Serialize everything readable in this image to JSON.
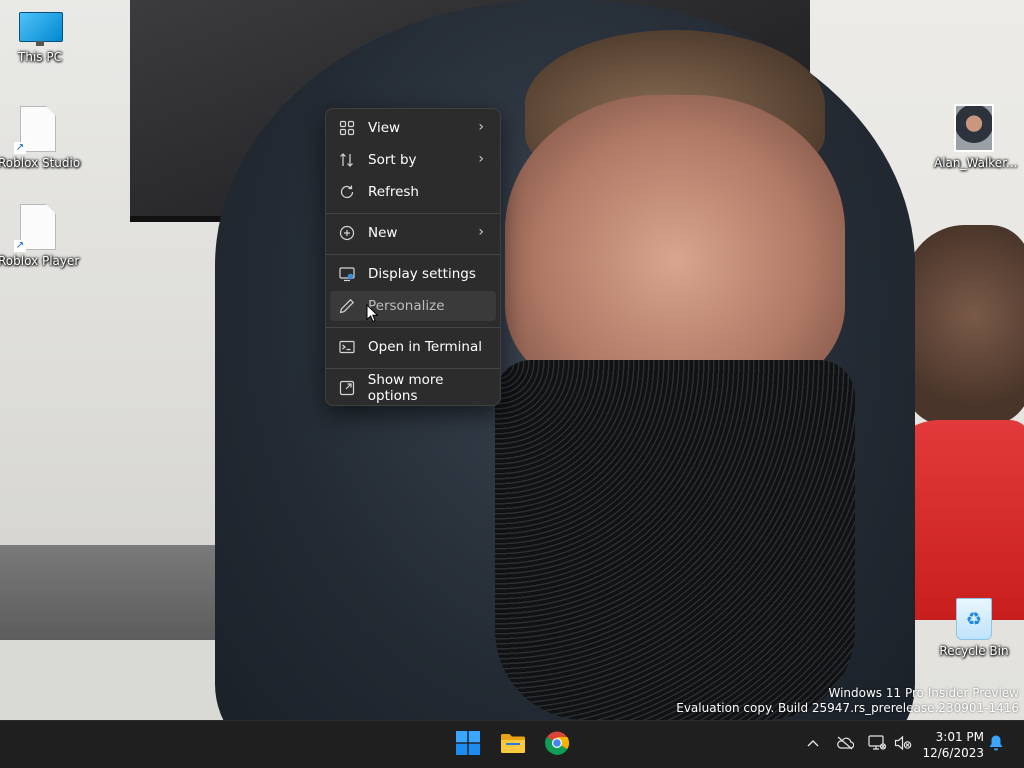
{
  "desktop": {
    "icons": [
      {
        "label": "This PC"
      },
      {
        "label": "Roblox Studio"
      },
      {
        "label": "Roblox Player"
      },
      {
        "label": "Alan_Walker..."
      },
      {
        "label": "Recycle Bin"
      }
    ]
  },
  "context_menu": {
    "items": [
      {
        "label": "View",
        "icon": "grid-view-icon",
        "has_submenu": true
      },
      {
        "label": "Sort by",
        "icon": "sort-icon",
        "has_submenu": true
      },
      {
        "label": "Refresh",
        "icon": "refresh-icon",
        "has_submenu": false
      },
      {
        "label": "New",
        "icon": "plus-circle-icon",
        "has_submenu": true
      },
      {
        "label": "Display settings",
        "icon": "display-settings-icon",
        "has_submenu": false
      },
      {
        "label": "Personalize",
        "icon": "pen-icon",
        "has_submenu": false,
        "hovered": true
      },
      {
        "label": "Open in Terminal",
        "icon": "terminal-icon",
        "has_submenu": false
      },
      {
        "label": "Show more options",
        "icon": "external-options-icon",
        "has_submenu": false
      }
    ]
  },
  "watermark": {
    "line1": "Windows 11 Pro Insider Preview",
    "line2": "Evaluation copy. Build 25947.rs_prerelease.230901-1416"
  },
  "taskbar": {
    "pinned": [
      {
        "name": "Start",
        "icon": "windows-logo-icon"
      },
      {
        "name": "File Explorer",
        "icon": "folder-icon"
      },
      {
        "name": "Google Chrome",
        "icon": "chrome-icon"
      }
    ],
    "tray": {
      "icons": [
        "chevron-up-icon",
        "onedrive-offline-icon",
        "network-icon",
        "volume-muted-icon",
        "notification-bell-icon"
      ]
    },
    "clock": {
      "time": "3:01 PM",
      "date": "12/6/2023"
    }
  },
  "colors": {
    "menu_bg": "#2c2c2c",
    "taskbar_bg": "#1f1f1f",
    "accent": "#0078d4"
  }
}
